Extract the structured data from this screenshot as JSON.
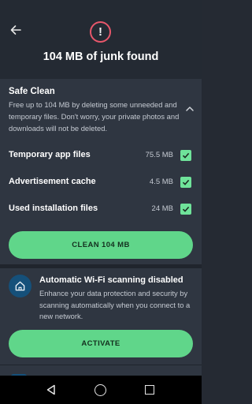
{
  "header": {
    "title": "104 MB of junk found",
    "alert_symbol": "!",
    "back_icon": "arrow-left-icon",
    "alert_color": "#e8576b"
  },
  "safe_clean": {
    "title": "Safe Clean",
    "description": "Free up to 104 MB by deleting some unneeded and temporary files. Don't worry, your private photos and downloads will not be deleted.",
    "collapse_icon": "chevron-up-icon",
    "items": [
      {
        "label": "Temporary app files",
        "size": "75.5 MB",
        "checked": true
      },
      {
        "label": "Advertisement cache",
        "size": "4.5 MB",
        "checked": true
      },
      {
        "label": "Used installation files",
        "size": "24 MB",
        "checked": true
      }
    ],
    "clean_button": "CLEAN 104 MB",
    "accent_color": "#60d68a"
  },
  "wifi": {
    "icon": "home-icon",
    "title": "Automatic Wi-Fi scanning disabled",
    "description": "Enhance your data protection and security by scanning automatically when you connect to a new network.",
    "activate_button": "ACTIVATE"
  },
  "navbar": {
    "back": "nav-back-icon",
    "home": "nav-home-icon",
    "recents": "nav-recents-icon"
  }
}
